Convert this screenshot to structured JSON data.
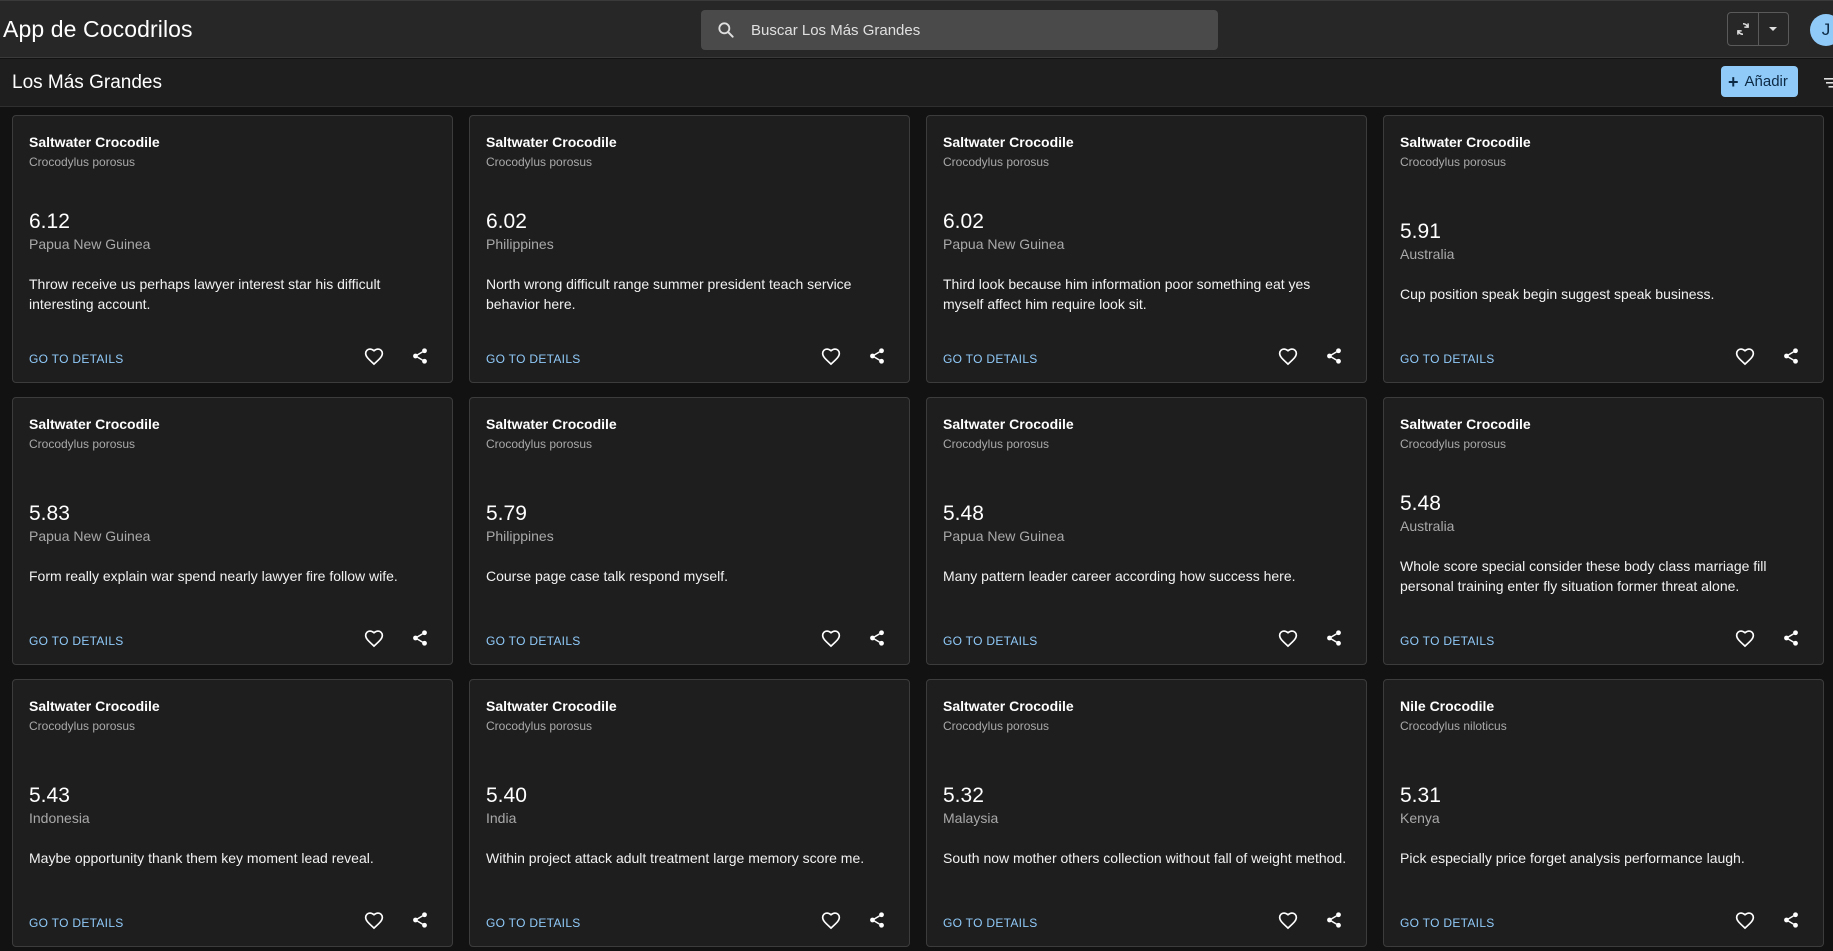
{
  "app": {
    "title": "App de Cocodrilos",
    "avatar_initial": "J"
  },
  "search": {
    "placeholder": "Buscar Los Más Grandes",
    "value": ""
  },
  "header_actions": {
    "refresh_icon": "refresh-icon",
    "menu_icon": "chevron-down-icon"
  },
  "toolbar": {
    "title": "Los Más Grandes",
    "add_label": "Añadir",
    "add_icon": "plus-icon",
    "filter_icon": "filter-icon"
  },
  "colors": {
    "accent": "#90caf9",
    "app_bar": "#272727",
    "card_bg": "#1e1e1e",
    "page_bg": "#121212"
  },
  "cards": [
    {
      "name": "Saltwater Crocodile",
      "scientific": "Crocodylus porosus",
      "size": "6.12",
      "country": "Papua New Guinea",
      "description": "Throw receive us perhaps lawyer interest star his difficult interesting account.",
      "details_label": "GO TO DETAILS"
    },
    {
      "name": "Saltwater Crocodile",
      "scientific": "Crocodylus porosus",
      "size": "6.02",
      "country": "Philippines",
      "description": "North wrong difficult range summer president teach service behavior here.",
      "details_label": "GO TO DETAILS"
    },
    {
      "name": "Saltwater Crocodile",
      "scientific": "Crocodylus porosus",
      "size": "6.02",
      "country": "Papua New Guinea",
      "description": "Third look because him information poor something eat yes myself affect him require look sit.",
      "details_label": "GO TO DETAILS"
    },
    {
      "name": "Saltwater Crocodile",
      "scientific": "Crocodylus porosus",
      "size": "5.91",
      "country": "Australia",
      "description": "Cup position speak begin suggest speak business.",
      "details_label": "GO TO DETAILS"
    },
    {
      "name": "Saltwater Crocodile",
      "scientific": "Crocodylus porosus",
      "size": "5.83",
      "country": "Papua New Guinea",
      "description": "Form really explain war spend nearly lawyer fire follow wife.",
      "details_label": "GO TO DETAILS"
    },
    {
      "name": "Saltwater Crocodile",
      "scientific": "Crocodylus porosus",
      "size": "5.79",
      "country": "Philippines",
      "description": "Course page case talk respond myself.",
      "details_label": "GO TO DETAILS"
    },
    {
      "name": "Saltwater Crocodile",
      "scientific": "Crocodylus porosus",
      "size": "5.48",
      "country": "Papua New Guinea",
      "description": "Many pattern leader career according how success here.",
      "details_label": "GO TO DETAILS"
    },
    {
      "name": "Saltwater Crocodile",
      "scientific": "Crocodylus porosus",
      "size": "5.48",
      "country": "Australia",
      "description": "Whole score special consider these body class marriage fill personal training enter fly situation former threat alone.",
      "details_label": "GO TO DETAILS"
    },
    {
      "name": "Saltwater Crocodile",
      "scientific": "Crocodylus porosus",
      "size": "5.43",
      "country": "Indonesia",
      "description": "Maybe opportunity thank them key moment lead reveal.",
      "details_label": "GO TO DETAILS"
    },
    {
      "name": "Saltwater Crocodile",
      "scientific": "Crocodylus porosus",
      "size": "5.40",
      "country": "India",
      "description": "Within project attack adult treatment large memory score me.",
      "details_label": "GO TO DETAILS"
    },
    {
      "name": "Saltwater Crocodile",
      "scientific": "Crocodylus porosus",
      "size": "5.32",
      "country": "Malaysia",
      "description": "South now mother others collection without fall of weight method.",
      "details_label": "GO TO DETAILS"
    },
    {
      "name": "Nile Crocodile",
      "scientific": "Crocodylus niloticus",
      "size": "5.31",
      "country": "Kenya",
      "description": "Pick especially price forget analysis performance laugh.",
      "details_label": "GO TO DETAILS"
    }
  ]
}
